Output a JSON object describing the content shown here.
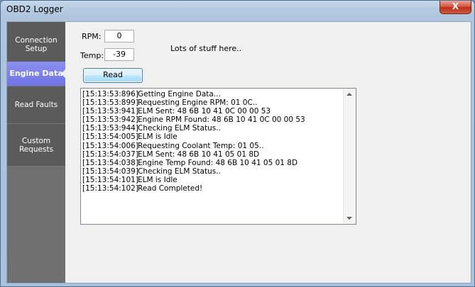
{
  "window": {
    "title": "OBD2 Logger",
    "close_label": "X"
  },
  "sidebar": {
    "items": [
      {
        "label_lines": [
          "Connection",
          "Setup"
        ],
        "active": false
      },
      {
        "label_lines": [
          "Engine Data"
        ],
        "active": true
      },
      {
        "label_lines": [
          "Read Faults"
        ],
        "active": false
      },
      {
        "label_lines": [
          "Custom",
          "Requests"
        ],
        "active": false
      }
    ]
  },
  "main": {
    "rpm_label": "RPM:",
    "rpm_value": "0",
    "temp_label": "Temp:",
    "temp_value": "-39",
    "info_text": "Lots of stuff here..",
    "read_button": "Read",
    "log": [
      {
        "time": "[15:13:53:896]",
        "msg": "Getting Engine Data..."
      },
      {
        "time": "[15:13:53:899]",
        "msg": "Requesting Engine RPM: 01 0C.."
      },
      {
        "time": "[15:13:53:941]",
        "msg": "ELM Sent: 48 6B 10 41 0C 00 00 53"
      },
      {
        "time": "[15:13:53:942]",
        "msg": "Engine RPM Found: 48 6B 10 41 0C 00 00 53"
      },
      {
        "time": "[15:13:53:944]",
        "msg": "Checking ELM Status.."
      },
      {
        "time": "[15:13:54:005]",
        "msg": "ELM is Idle"
      },
      {
        "time": "[15:13:54:006]",
        "msg": "Requesting Coolant Temp: 01 05.."
      },
      {
        "time": "[15:13:54:037]",
        "msg": "ELM Sent: 48 6B 10 41 05 01 8D"
      },
      {
        "time": "[15:13:54:038]",
        "msg": "Engine Temp Found: 48 6B 10 41 05 01 8D"
      },
      {
        "time": "[15:13:54:039]",
        "msg": "Checking ELM Status.."
      },
      {
        "time": "[15:13:54:101]",
        "msg": "ELM is Idle"
      },
      {
        "time": "[15:13:54:102]",
        "msg": "Read Completed!"
      }
    ]
  }
}
